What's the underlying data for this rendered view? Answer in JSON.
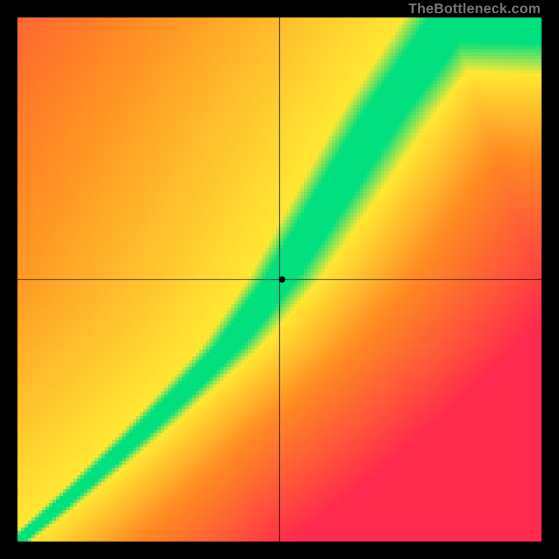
{
  "watermark": "TheBottleneck.com",
  "colors": {
    "background": "#000000",
    "red": "#ff2a4d",
    "orange": "#ff8a22",
    "yellow": "#ffe733",
    "green": "#00e07e",
    "axis": "#000000",
    "marker": "#000000"
  },
  "chart_data": {
    "type": "heatmap",
    "title": "",
    "xlabel": "",
    "ylabel": "",
    "xlim": [
      0,
      1
    ],
    "ylim": [
      0,
      1
    ],
    "grid_resolution": 150,
    "crosshair": {
      "x": 0.5,
      "y": 0.5
    },
    "marker": {
      "x": 0.505,
      "y": 0.5,
      "radius_px": 4.5
    },
    "optimal_curve": {
      "description": "centerline of the green optimal band (normalized coords, origin bottom-left)",
      "points": [
        {
          "x": 0.0,
          "y": 0.0
        },
        {
          "x": 0.1,
          "y": 0.085
        },
        {
          "x": 0.2,
          "y": 0.175
        },
        {
          "x": 0.3,
          "y": 0.27
        },
        {
          "x": 0.4,
          "y": 0.37
        },
        {
          "x": 0.5,
          "y": 0.5
        },
        {
          "x": 0.6,
          "y": 0.66
        },
        {
          "x": 0.7,
          "y": 0.82
        },
        {
          "x": 0.78,
          "y": 0.93
        },
        {
          "x": 0.83,
          "y": 1.0
        }
      ]
    },
    "band_half_width": {
      "description": "approximate half-width of the green band along x, as a function of x",
      "samples": [
        {
          "x": 0.0,
          "w": 0.01
        },
        {
          "x": 0.2,
          "w": 0.018
        },
        {
          "x": 0.4,
          "w": 0.028
        },
        {
          "x": 0.6,
          "w": 0.04
        },
        {
          "x": 0.8,
          "w": 0.05
        },
        {
          "x": 1.0,
          "w": 0.055
        }
      ]
    },
    "color_scale": {
      "description": "distance-from-optimal → color stops",
      "stops": [
        {
          "d": 0.0,
          "color": "green"
        },
        {
          "d": 0.05,
          "color": "green"
        },
        {
          "d": 0.1,
          "color": "yellow"
        },
        {
          "d": 0.35,
          "color": "orange"
        },
        {
          "d": 0.8,
          "color": "red"
        }
      ]
    }
  }
}
